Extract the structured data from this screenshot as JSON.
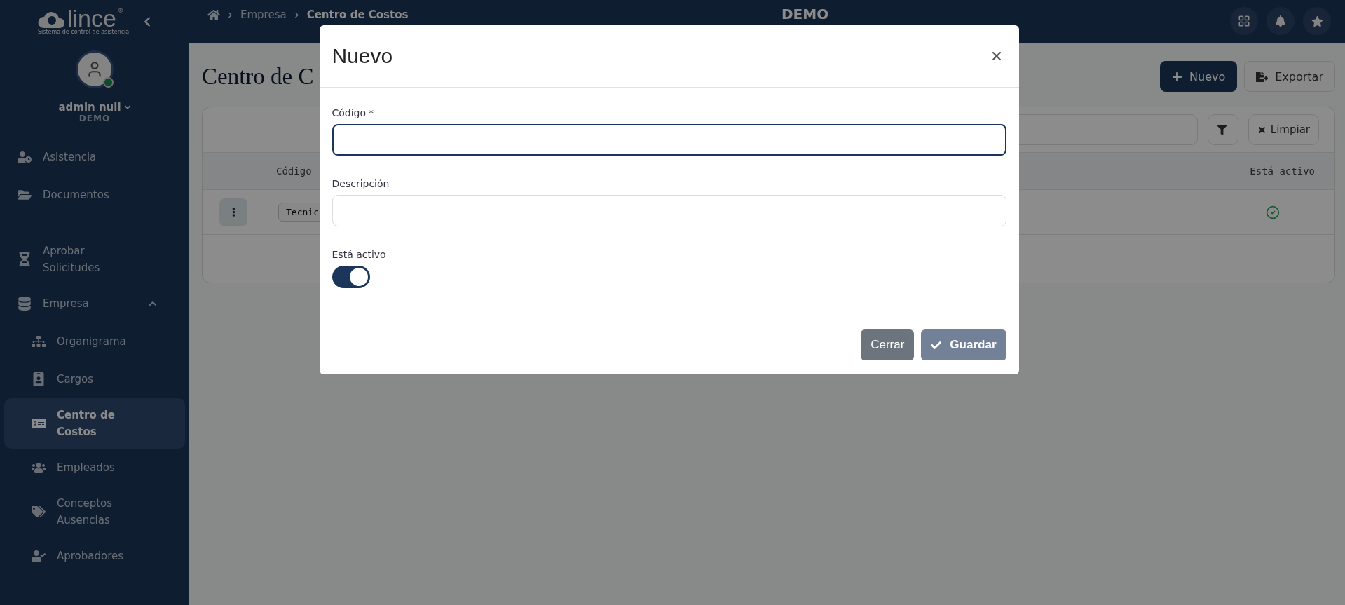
{
  "header": {
    "logo_text": "lince",
    "logo_mark": "®",
    "logo_tagline": "Sistema de control de asistencia",
    "breadcrumb": [
      "Empresa",
      "Centro de Costos"
    ],
    "title": "DEMO"
  },
  "user": {
    "name": "admin null",
    "company": "DEMO",
    "online": true
  },
  "sidebar": {
    "sections": [
      {
        "items": [
          {
            "label": "Asistencia",
            "selected": false
          },
          {
            "label": "Documentos",
            "selected": false
          }
        ]
      },
      {
        "items": [
          {
            "label": "Aprobar Solicitudes",
            "selected": false
          },
          {
            "label": "Empresa",
            "selected": false,
            "expanded": true,
            "children": [
              {
                "label": "Organigrama",
                "selected": false
              },
              {
                "label": "Cargos",
                "selected": false
              },
              {
                "label": "Centro de Costos",
                "selected": true
              },
              {
                "label": "Empleados",
                "selected": false
              },
              {
                "label": "Conceptos Ausencias",
                "selected": false
              },
              {
                "label": "Aprobadores",
                "selected": false
              }
            ]
          }
        ]
      }
    ]
  },
  "page": {
    "title": "Centro de C",
    "actions": [
      {
        "kind": "primary",
        "label": "Nuevo"
      },
      {
        "kind": "export",
        "label": "Exportar"
      }
    ],
    "clear_label": "Limpiar",
    "table": {
      "columns": [
        "Código",
        "Está activo"
      ],
      "rows": [
        {
          "code": "Tecnic",
          "active": true
        }
      ]
    }
  },
  "modal": {
    "title": "Nuevo",
    "fields": [
      {
        "kind": "text",
        "label": "Código",
        "required_mark": "*",
        "focused": true
      },
      {
        "kind": "text",
        "label": "Descripción",
        "focused": false
      },
      {
        "kind": "switch",
        "label": "Está activo",
        "on": true
      }
    ],
    "cancel_label": "Cerrar",
    "save_label": "Guardar",
    "save_disabled": true
  }
}
